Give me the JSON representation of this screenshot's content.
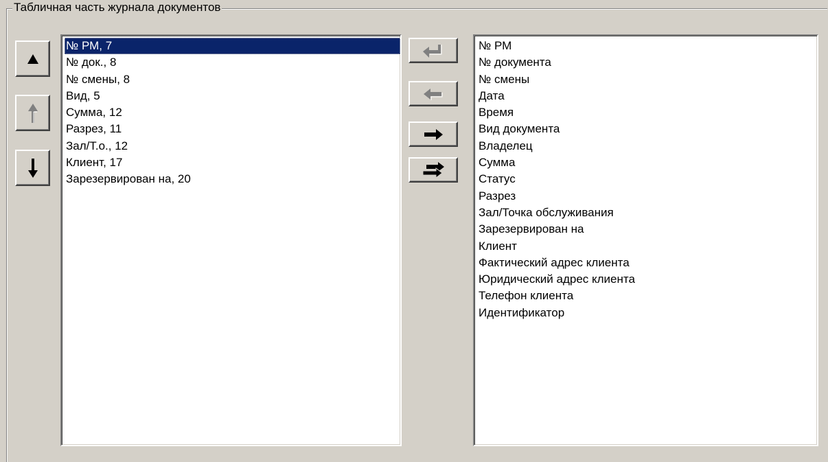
{
  "group": {
    "title": "Табличная часть журнала документов"
  },
  "selected_list": {
    "items": [
      "№ РМ, 7",
      "№ док., 8",
      "№ смены, 8",
      "Вид, 5",
      "Сумма, 12",
      "Разрез, 11",
      "Зал/Т.о., 12",
      "Клиент, 17",
      "Зарезервирован на, 20"
    ],
    "selected_index": 0
  },
  "available_list": {
    "items": [
      "№ РМ",
      "№ документа",
      "№ смены",
      "Дата",
      "Время",
      "Вид документа",
      "Владелец",
      "Сумма",
      "Статус",
      "Разрез",
      "Зал/Точка обслуживания",
      "Зарезервирован на",
      "Клиент",
      "Фактический адрес клиента",
      "Юридический адрес клиента",
      "Телефон клиента",
      "Идентификатор"
    ]
  },
  "icons": {
    "move_top": "triangle-up-icon",
    "move_up": "arrow-up-icon",
    "move_down": "arrow-down-icon",
    "add_all": "return-arrow-icon",
    "add_one": "arrow-left-icon",
    "remove_one": "arrow-right-icon",
    "remove_all": "double-arrow-right-icon"
  },
  "colors": {
    "face": "#d4d0c8",
    "selection": "#0a246a",
    "disabled_icon": "#808080"
  }
}
